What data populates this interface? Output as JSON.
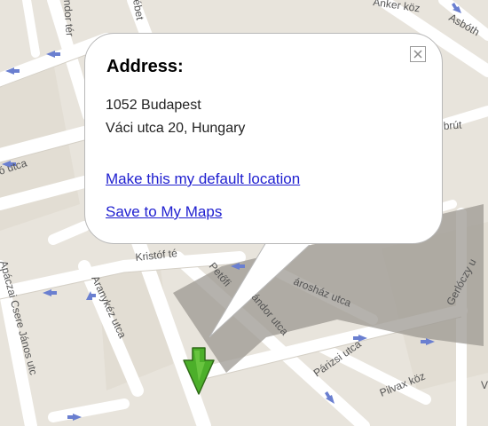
{
  "map": {
    "streets": [
      {
        "id": "ankerkoz",
        "text": "Anker köz"
      },
      {
        "id": "asboth",
        "text": "Asbóth"
      },
      {
        "id": "ndorter",
        "text": "ndor tér"
      },
      {
        "id": "sebet",
        "text": "ébet"
      },
      {
        "id": "utca-left",
        "text": "ó utca"
      },
      {
        "id": "krisztof",
        "text": "Kristóf té"
      },
      {
        "id": "petofi",
        "text": "Petőfi"
      },
      {
        "id": "varoshaz",
        "text": "árosház utca"
      },
      {
        "id": "gerloczy",
        "text": "Gerlóczy u"
      },
      {
        "id": "brut",
        "text": "brút"
      },
      {
        "id": "aranykez",
        "text": "Aranykéz utca"
      },
      {
        "id": "csere",
        "text": "Apáczai Csere János utc"
      },
      {
        "id": "sandor",
        "text": "ándor utca"
      },
      {
        "id": "parizsi",
        "text": "Párizsi utca"
      },
      {
        "id": "pilvax",
        "text": "Pilvax köz"
      },
      {
        "id": "v-edge",
        "text": "V"
      }
    ],
    "marker_icon": "green-arrow-marker-icon"
  },
  "popup": {
    "title": "Address:",
    "address_line1": "1052 Budapest",
    "address_line2": "Váci utca 20, Hungary",
    "link_default": "Make this my default location",
    "link_save": "Save to My Maps",
    "close_icon": "close-icon"
  },
  "colors": {
    "map_bg": "#e8e4dc",
    "road": "#ffffff",
    "link": "#2020d0",
    "marker": "#4caf2a",
    "arrow": "#6a7fd0"
  }
}
